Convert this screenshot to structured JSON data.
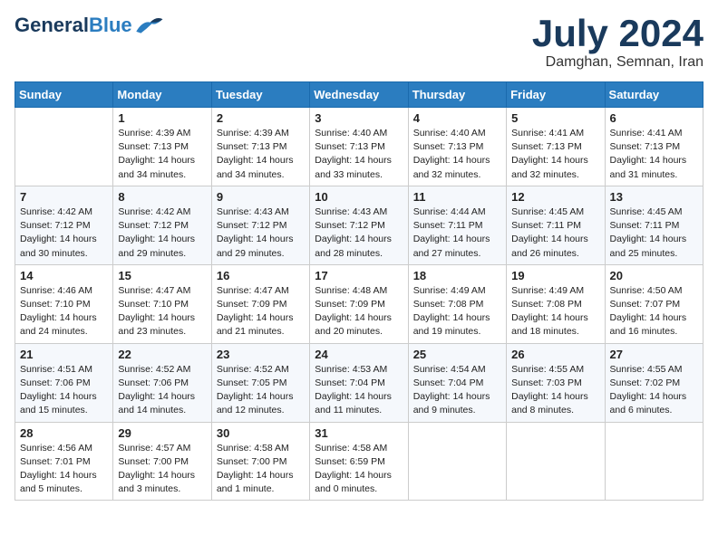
{
  "header": {
    "logo_line1": "General",
    "logo_line2": "Blue",
    "month_year": "July 2024",
    "location": "Damghan, Semnan, Iran"
  },
  "weekdays": [
    "Sunday",
    "Monday",
    "Tuesday",
    "Wednesday",
    "Thursday",
    "Friday",
    "Saturday"
  ],
  "rows": [
    [
      {
        "day": "",
        "text": ""
      },
      {
        "day": "1",
        "text": "Sunrise: 4:39 AM\nSunset: 7:13 PM\nDaylight: 14 hours\nand 34 minutes."
      },
      {
        "day": "2",
        "text": "Sunrise: 4:39 AM\nSunset: 7:13 PM\nDaylight: 14 hours\nand 34 minutes."
      },
      {
        "day": "3",
        "text": "Sunrise: 4:40 AM\nSunset: 7:13 PM\nDaylight: 14 hours\nand 33 minutes."
      },
      {
        "day": "4",
        "text": "Sunrise: 4:40 AM\nSunset: 7:13 PM\nDaylight: 14 hours\nand 32 minutes."
      },
      {
        "day": "5",
        "text": "Sunrise: 4:41 AM\nSunset: 7:13 PM\nDaylight: 14 hours\nand 32 minutes."
      },
      {
        "day": "6",
        "text": "Sunrise: 4:41 AM\nSunset: 7:13 PM\nDaylight: 14 hours\nand 31 minutes."
      }
    ],
    [
      {
        "day": "7",
        "text": "Sunrise: 4:42 AM\nSunset: 7:12 PM\nDaylight: 14 hours\nand 30 minutes."
      },
      {
        "day": "8",
        "text": "Sunrise: 4:42 AM\nSunset: 7:12 PM\nDaylight: 14 hours\nand 29 minutes."
      },
      {
        "day": "9",
        "text": "Sunrise: 4:43 AM\nSunset: 7:12 PM\nDaylight: 14 hours\nand 29 minutes."
      },
      {
        "day": "10",
        "text": "Sunrise: 4:43 AM\nSunset: 7:12 PM\nDaylight: 14 hours\nand 28 minutes."
      },
      {
        "day": "11",
        "text": "Sunrise: 4:44 AM\nSunset: 7:11 PM\nDaylight: 14 hours\nand 27 minutes."
      },
      {
        "day": "12",
        "text": "Sunrise: 4:45 AM\nSunset: 7:11 PM\nDaylight: 14 hours\nand 26 minutes."
      },
      {
        "day": "13",
        "text": "Sunrise: 4:45 AM\nSunset: 7:11 PM\nDaylight: 14 hours\nand 25 minutes."
      }
    ],
    [
      {
        "day": "14",
        "text": "Sunrise: 4:46 AM\nSunset: 7:10 PM\nDaylight: 14 hours\nand 24 minutes."
      },
      {
        "day": "15",
        "text": "Sunrise: 4:47 AM\nSunset: 7:10 PM\nDaylight: 14 hours\nand 23 minutes."
      },
      {
        "day": "16",
        "text": "Sunrise: 4:47 AM\nSunset: 7:09 PM\nDaylight: 14 hours\nand 21 minutes."
      },
      {
        "day": "17",
        "text": "Sunrise: 4:48 AM\nSunset: 7:09 PM\nDaylight: 14 hours\nand 20 minutes."
      },
      {
        "day": "18",
        "text": "Sunrise: 4:49 AM\nSunset: 7:08 PM\nDaylight: 14 hours\nand 19 minutes."
      },
      {
        "day": "19",
        "text": "Sunrise: 4:49 AM\nSunset: 7:08 PM\nDaylight: 14 hours\nand 18 minutes."
      },
      {
        "day": "20",
        "text": "Sunrise: 4:50 AM\nSunset: 7:07 PM\nDaylight: 14 hours\nand 16 minutes."
      }
    ],
    [
      {
        "day": "21",
        "text": "Sunrise: 4:51 AM\nSunset: 7:06 PM\nDaylight: 14 hours\nand 15 minutes."
      },
      {
        "day": "22",
        "text": "Sunrise: 4:52 AM\nSunset: 7:06 PM\nDaylight: 14 hours\nand 14 minutes."
      },
      {
        "day": "23",
        "text": "Sunrise: 4:52 AM\nSunset: 7:05 PM\nDaylight: 14 hours\nand 12 minutes."
      },
      {
        "day": "24",
        "text": "Sunrise: 4:53 AM\nSunset: 7:04 PM\nDaylight: 14 hours\nand 11 minutes."
      },
      {
        "day": "25",
        "text": "Sunrise: 4:54 AM\nSunset: 7:04 PM\nDaylight: 14 hours\nand 9 minutes."
      },
      {
        "day": "26",
        "text": "Sunrise: 4:55 AM\nSunset: 7:03 PM\nDaylight: 14 hours\nand 8 minutes."
      },
      {
        "day": "27",
        "text": "Sunrise: 4:55 AM\nSunset: 7:02 PM\nDaylight: 14 hours\nand 6 minutes."
      }
    ],
    [
      {
        "day": "28",
        "text": "Sunrise: 4:56 AM\nSunset: 7:01 PM\nDaylight: 14 hours\nand 5 minutes."
      },
      {
        "day": "29",
        "text": "Sunrise: 4:57 AM\nSunset: 7:00 PM\nDaylight: 14 hours\nand 3 minutes."
      },
      {
        "day": "30",
        "text": "Sunrise: 4:58 AM\nSunset: 7:00 PM\nDaylight: 14 hours\nand 1 minute."
      },
      {
        "day": "31",
        "text": "Sunrise: 4:58 AM\nSunset: 6:59 PM\nDaylight: 14 hours\nand 0 minutes."
      },
      {
        "day": "",
        "text": ""
      },
      {
        "day": "",
        "text": ""
      },
      {
        "day": "",
        "text": ""
      }
    ]
  ]
}
